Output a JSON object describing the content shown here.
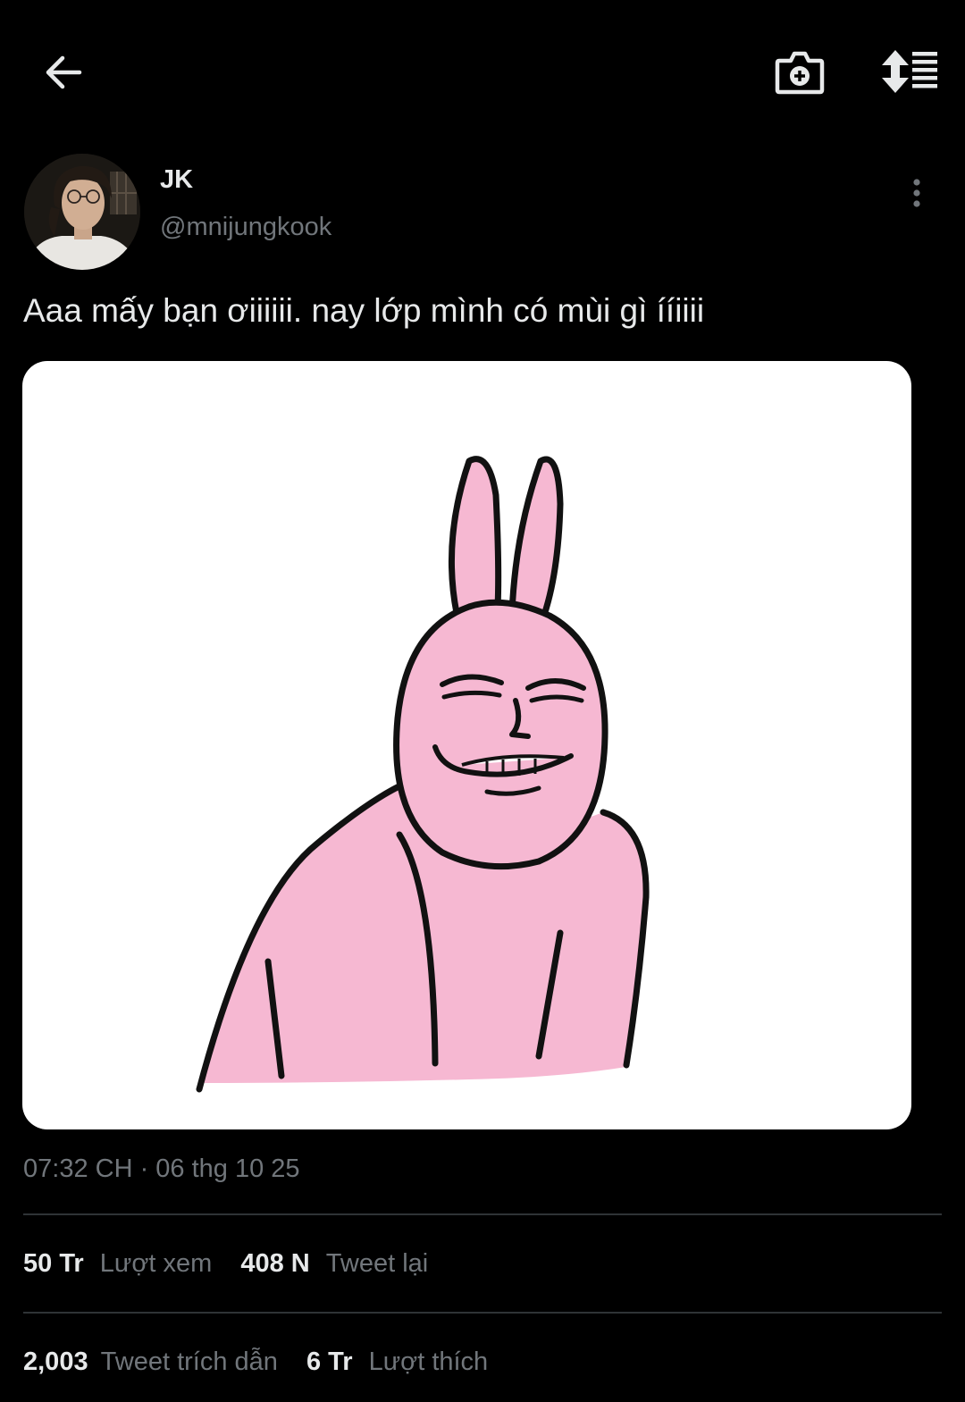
{
  "header": {
    "back_icon": "arrow-left-icon",
    "camera_icon": "camera-add-icon",
    "sort_icon": "sort-list-icon"
  },
  "tweet": {
    "author_name": "JK",
    "author_handle": "@mnijungkook",
    "more_icon": "more-vertical-icon",
    "text": "Aaa mấy bạn ơiiiiii. nay lớp mình có mùi gì ííiiii",
    "media_description_icon": "pink-bunny-sticker",
    "timestamp": "07:32 CH · 06 thg 10 25"
  },
  "stats": {
    "views_count": "50 Tr",
    "views_label": "Lượt xem",
    "retweets_count": "408 N",
    "retweets_label": "Tweet lại",
    "quotes_count": "2,003",
    "quotes_label": "Tweet trích dẫn",
    "likes_count": "6 Tr",
    "likes_label": "Lượt thích"
  },
  "colors": {
    "background": "#000000",
    "text_primary": "#e7e9ea",
    "text_secondary": "#71767b",
    "divider": "#2f3336",
    "bunny_pink": "#f6b8d2"
  }
}
